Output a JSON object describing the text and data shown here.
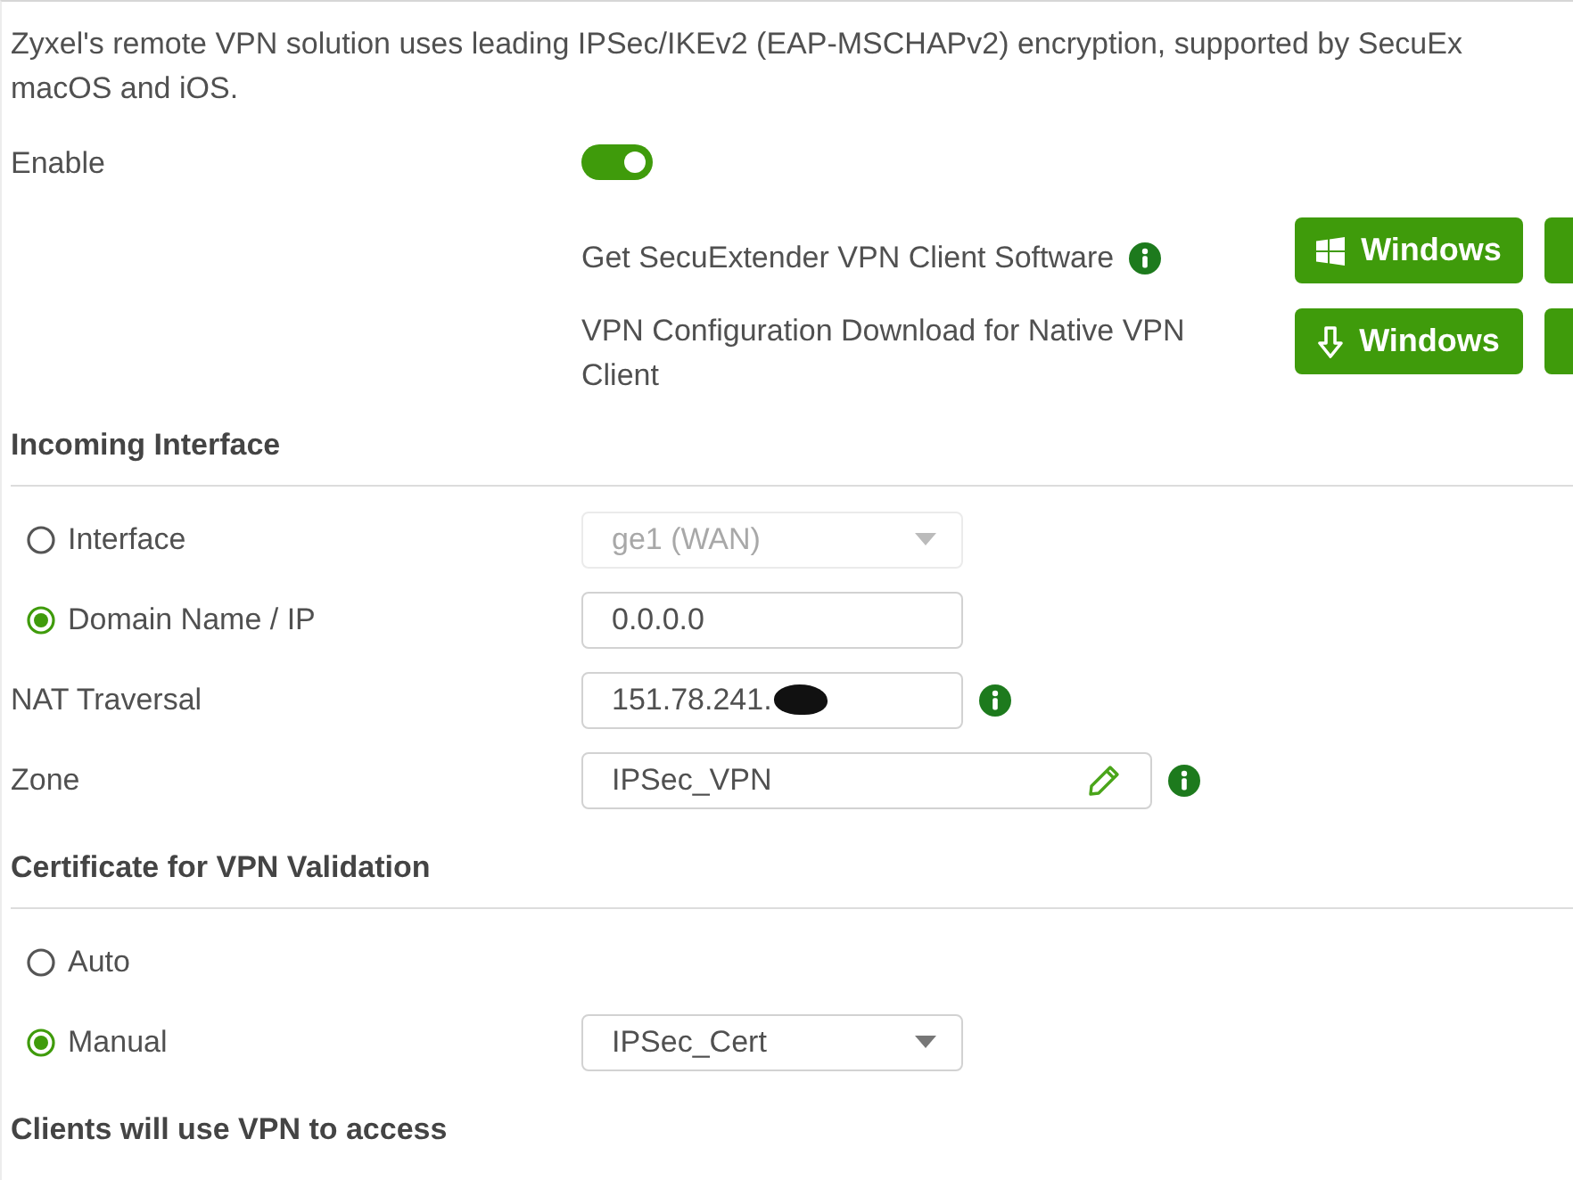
{
  "description": [
    "Zyxel's remote VPN solution uses leading IPSec/IKEv2 (EAP-MSCHAPv2) encryption, supported by SecuEx",
    "macOS and iOS."
  ],
  "enable": {
    "label": "Enable",
    "on": true
  },
  "downloads": [
    {
      "label": "Get SecuExtender VPN Client Software",
      "info": true,
      "buttons": [
        {
          "kind": "windows",
          "label": "Windows"
        },
        {
          "kind": "partial"
        }
      ]
    },
    {
      "label": "VPN Configuration Download for Native VPN Client",
      "buttons": [
        {
          "kind": "download",
          "label": "Windows"
        },
        {
          "kind": "partial"
        }
      ]
    }
  ],
  "sections": [
    {
      "title": "Incoming Interface",
      "rows": [
        {
          "kind": "radio",
          "label": "Interface",
          "selected": false,
          "field": {
            "kind": "select",
            "value": "ge1 (WAN)",
            "disabled": true
          }
        },
        {
          "kind": "radio",
          "label": "Domain Name / IP",
          "selected": true,
          "field": {
            "kind": "text",
            "value": "0.0.0.0",
            "disabled": false
          }
        },
        {
          "kind": "plain",
          "label": "NAT Traversal",
          "field": {
            "kind": "text",
            "value": "151.78.241.",
            "disabled": false,
            "redacted": true,
            "info": true
          }
        },
        {
          "kind": "plain",
          "label": "Zone",
          "field": {
            "kind": "picker",
            "value": "IPSec_VPN",
            "disabled": false,
            "info": true
          }
        }
      ]
    },
    {
      "title": "Certificate for VPN Validation",
      "rows": [
        {
          "kind": "radio",
          "label": "Auto",
          "selected": false
        },
        {
          "kind": "radio",
          "label": "Manual",
          "selected": true,
          "field": {
            "kind": "select",
            "value": "IPSec_Cert",
            "disabled": false
          }
        }
      ]
    },
    {
      "title": "Clients will use VPN to access"
    }
  ]
}
